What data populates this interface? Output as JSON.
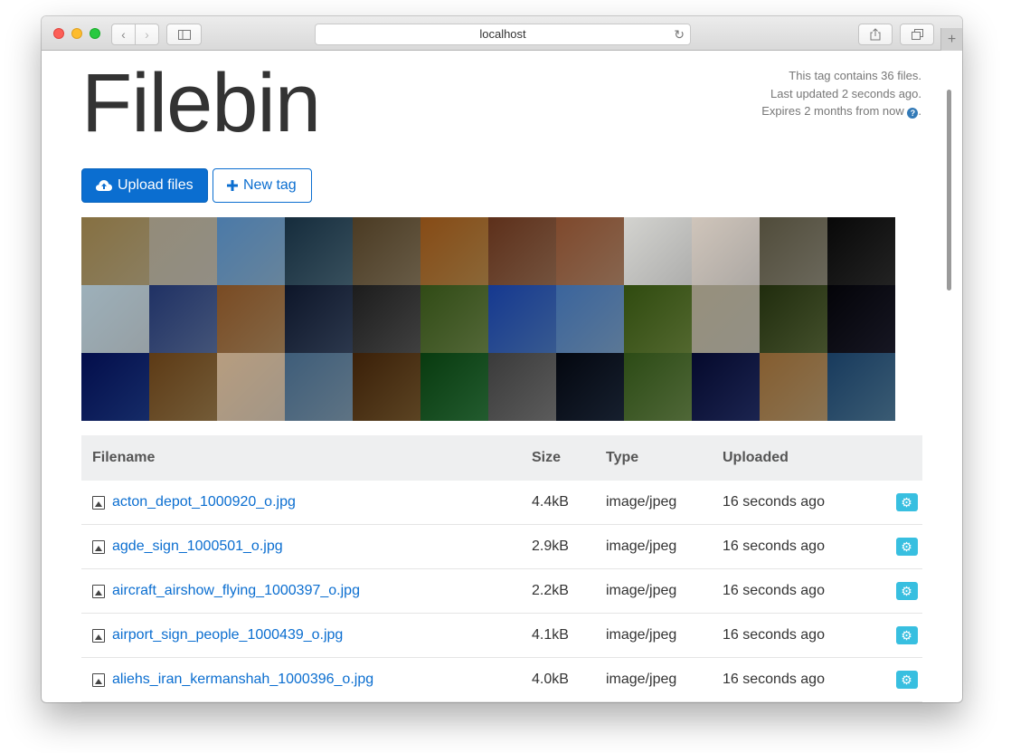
{
  "browser": {
    "url": "localhost",
    "nav_back": "‹",
    "nav_forward": "›",
    "newtab": "+"
  },
  "header": {
    "brand": "Filebin",
    "info_line1": "This tag contains 36 files.",
    "info_line2": "Last updated 2 seconds ago.",
    "info_line3": "Expires 2 months from now",
    "help_icon": "?"
  },
  "actions": {
    "upload_label": "Upload files",
    "newtag_label": "New tag"
  },
  "thumbnails": [
    "#b9a981",
    "#c2bdb0",
    "#8ab0cf",
    "#4a6a7c",
    "#8a7a5e",
    "#b98a4a",
    "#9a6e52",
    "#b4886a",
    "#e8e8e6",
    "#e6e0da",
    "#8f8b7a",
    "#2e2e2e",
    "#c8d4da",
    "#5a70a0",
    "#b08a5e",
    "#3a4a66",
    "#555555",
    "#6f8a4a",
    "#4a78c0",
    "#7aa0c8",
    "#6e8a3e",
    "#c4c0b2",
    "#5a6a3a",
    "#1e1e2e",
    "#1c3a8a",
    "#9a7a4a",
    "#d8c8b4",
    "#7e9ab0",
    "#7a5a2e",
    "#2e7a3e",
    "#7a7a7a",
    "#1e2a3e",
    "#6a8a4a",
    "#24306a",
    "#b89a6e",
    "#4e7a9a"
  ],
  "table": {
    "headers": {
      "filename": "Filename",
      "size": "Size",
      "type": "Type",
      "uploaded": "Uploaded"
    },
    "rows": [
      {
        "filename": "acton_depot_1000920_o.jpg",
        "size": "4.4kB",
        "type": "image/jpeg",
        "uploaded": "16 seconds ago"
      },
      {
        "filename": "agde_sign_1000501_o.jpg",
        "size": "2.9kB",
        "type": "image/jpeg",
        "uploaded": "16 seconds ago"
      },
      {
        "filename": "aircraft_airshow_flying_1000397_o.jpg",
        "size": "2.2kB",
        "type": "image/jpeg",
        "uploaded": "16 seconds ago"
      },
      {
        "filename": "airport_sign_people_1000439_o.jpg",
        "size": "4.1kB",
        "type": "image/jpeg",
        "uploaded": "16 seconds ago"
      },
      {
        "filename": "aliehs_iran_kermanshah_1000396_o.jpg",
        "size": "4.0kB",
        "type": "image/jpeg",
        "uploaded": "16 seconds ago"
      }
    ]
  }
}
